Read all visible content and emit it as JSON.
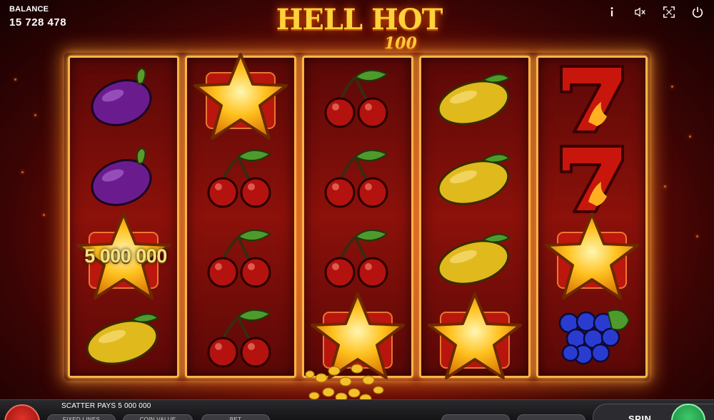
{
  "balance": {
    "label": "BALANCE",
    "value": "15 728 478"
  },
  "logo": {
    "title": "HELL HOT",
    "subtitle": "100"
  },
  "top_icons": [
    "info-icon",
    "sound-muted-icon",
    "fullscreen-icon",
    "power-icon"
  ],
  "reels": [
    [
      "plum",
      "plum",
      "star",
      "lemon"
    ],
    [
      "star",
      "cherry",
      "cherry",
      "cherry"
    ],
    [
      "cherry",
      "cherry",
      "cherry",
      "star"
    ],
    [
      "lemon",
      "lemon",
      "lemon",
      "star"
    ],
    [
      "seven",
      "seven",
      "star",
      "grapes"
    ]
  ],
  "win_amount": "5 000 000",
  "status": {
    "message": "SCATTER PAYS 5 000 000"
  },
  "controls": {
    "fixed_lines": "FIXED LINES",
    "coin_value": "COIN VALUE",
    "bet": "BET",
    "spin": "SPIN"
  },
  "colors": {
    "background": "#8a0f06",
    "reel_border": "#ffb444",
    "logo": "#ffd23a",
    "win_text": "#f6e27e",
    "spin_button": "#3ec86a"
  }
}
